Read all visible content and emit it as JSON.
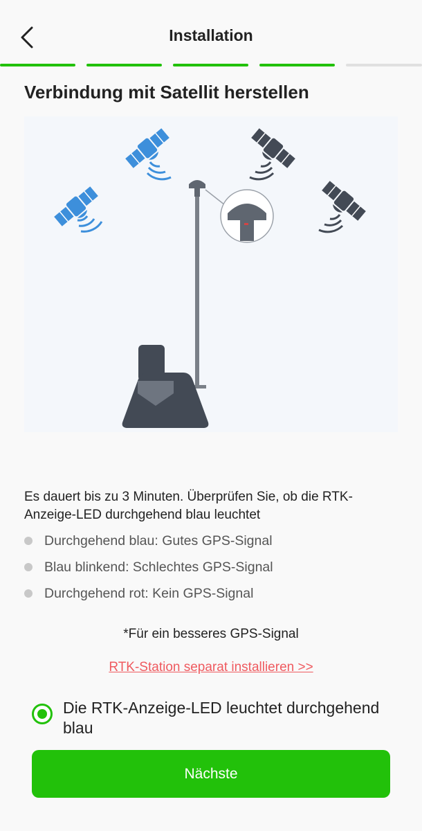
{
  "header": {
    "title": "Installation",
    "back_icon": "chevron-left-icon",
    "progress_steps": [
      {
        "state": "done"
      },
      {
        "state": "done"
      },
      {
        "state": "done"
      },
      {
        "state": "done"
      },
      {
        "state": "pending"
      }
    ]
  },
  "step": {
    "heading": "Verbindung mit Satellit herstellen",
    "illustration": "rtk-station-satellite-illustration"
  },
  "content": {
    "description": "Es dauert bis zu 3 Minuten. Überprüfen Sie, ob die RTK-Anzeige-LED durchgehend blau leuchtet",
    "bullets": [
      "Durchgehend blau: Gutes GPS-Signal",
      "Blau blinkend: Schlechtes GPS-Signal",
      "Durchgehend rot: Kein GPS-Signal"
    ],
    "note": "*Für ein besseres GPS-Signal",
    "link": "RTK-Station separat installieren >>"
  },
  "confirm": {
    "label": "Die RTK-Anzeige-LED leuchtet durchgehend blau",
    "checked": true
  },
  "next_button": {
    "label": "Nächste"
  },
  "colors": {
    "accent": "#22c10a",
    "link": "#ef5a5f",
    "progress_pending": "#e0e0e0",
    "satellite_blue": "#3d8fdb",
    "satellite_dark": "#434a55"
  }
}
